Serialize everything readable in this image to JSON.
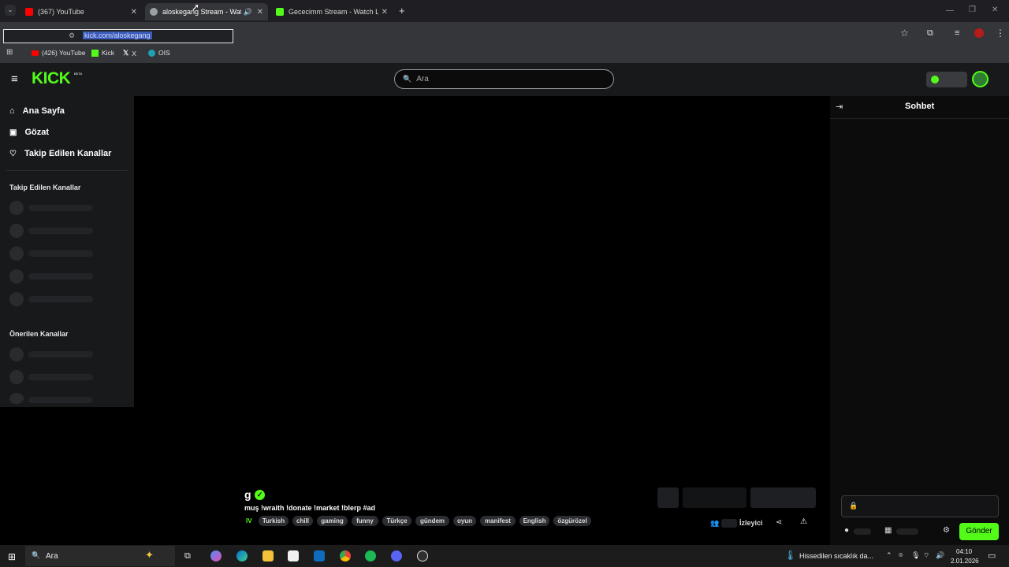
{
  "browser": {
    "tabs": [
      {
        "title": "(367) YouTube",
        "color": "#ff0000"
      },
      {
        "title": "aloskegang Stream - Watch",
        "color": "#9aa0a6",
        "active": true
      },
      {
        "title": "Gececimm Stream - Watch Live",
        "color": "#53fc18"
      }
    ],
    "new_tab": "+",
    "url": "kick.com/aloskegang",
    "bookmarks": [
      {
        "label": "(426) YouTube",
        "color": "#ff0000"
      },
      {
        "label": "Kick",
        "color": "#53fc18"
      },
      {
        "label": "X",
        "color": "#ffffff"
      },
      {
        "label": "OIS",
        "color": "#1ea2b6"
      }
    ]
  },
  "kick": {
    "logo": "KICK",
    "logo_beta": "BETA",
    "search_placeholder": "Ara",
    "nav": [
      {
        "label": "Ana Sayfa",
        "icon": "home-icon"
      },
      {
        "label": "Gözat",
        "icon": "browse-icon"
      },
      {
        "label": "Takip Edilen Kanallar",
        "icon": "heart-icon"
      }
    ],
    "section_following": "Takip Edilen Kanallar",
    "section_recommended": "Önerilen Kanallar",
    "chat_title": "Sohbet",
    "send_button": "Gönder",
    "viewers_label": "İzleyici",
    "channel_initial": "g",
    "stream_title": "muş !wraith !donate !market !blerp #ad",
    "live_prefix": "IV",
    "tags": [
      "Turkish",
      "chill",
      "gaming",
      "funny",
      "Türkçe",
      "gündem",
      "oyun",
      "manifest",
      "English",
      "özgürözel"
    ],
    "accent": "#53fc18"
  },
  "taskbar": {
    "search": "Ara",
    "weather": "Hissedilen sıcaklık da...",
    "time": "04:10",
    "date": "2.01.2026"
  }
}
